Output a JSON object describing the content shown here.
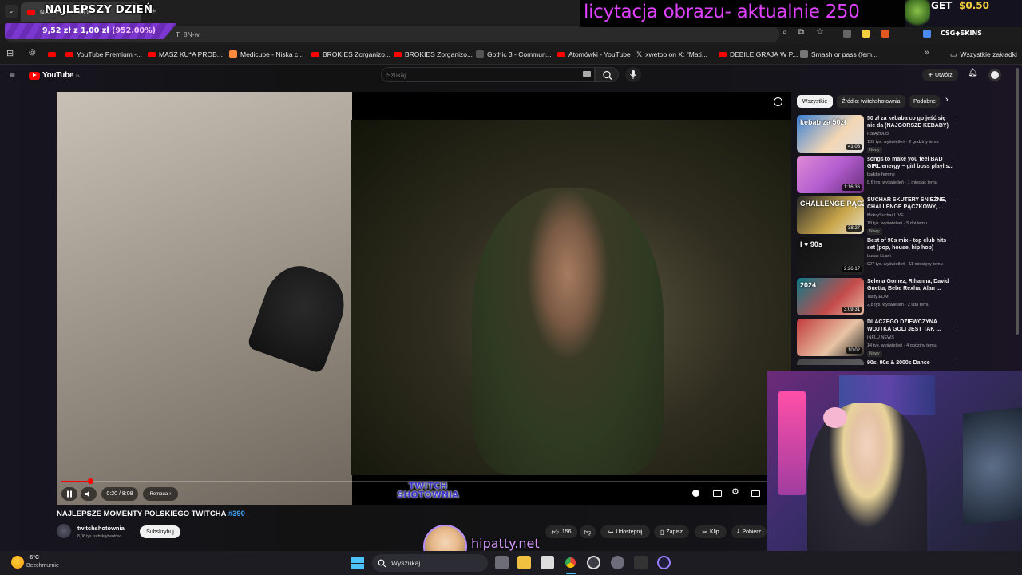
{
  "browser": {
    "tab_title": "NAJLEPSZE MO...",
    "url_fragment": "T_8N-w",
    "bookmarks": [
      "YouTube Premium -...",
      "MASZ KU*A PROB...",
      "Medicube - Niska c...",
      "BROKIES Zorganizo...",
      "BROKIES Zorganizo...",
      "Gothic 3 - Commun...",
      "Atomówki - YouTube",
      "xwetoo on X: \"Mati...",
      "DEBILE GRAJĄ W P...",
      "Smash or pass (fem..."
    ],
    "all_bookmarks": "Wszystkie zakładki"
  },
  "youtube": {
    "logo": "YouTube",
    "logo_region": "PL",
    "search_placeholder": "Szukaj",
    "create_label": "Utwórz",
    "video": {
      "title": "NAJLEPSZE MOMENTY POLSKIEGO TWITCHA",
      "hashtag": "#390",
      "time": "0:20 / 8:08",
      "chapter": "Remaua",
      "watermark": "TWITCH SHOTOWNIA",
      "progress": 0.04
    },
    "channel": {
      "name": "twitchshotownia",
      "subs": "8,06 tys. subskrybentów",
      "subscribe": "Subskrybuj"
    },
    "actions": {
      "likes": "156",
      "share": "Udostępnij",
      "save": "Zapisz",
      "clip": "Klip",
      "download": "Pobierz"
    },
    "chips": [
      "Wszystkie",
      "Źródło: twitchshotownia",
      "Podobne"
    ],
    "recommendations": [
      {
        "title": "50 zł za kebaba co go jeść się nie da (NAJGORSZE KEBABY)",
        "channel": "KSIĄŻULO",
        "meta": "139 tys. wyświetleń · 2 godziny temu",
        "badge": "Nowy",
        "duration": "41:06",
        "thumb_text": "kebab za 50zł"
      },
      {
        "title": "songs to make you feel BAD GIRL energy ~ girl boss playlis...",
        "channel": "baddie femme",
        "meta": "8,6 tys. wyświetleń · 1 miesiąc temu",
        "badge": "",
        "duration": "1:16:36",
        "thumb_text": ""
      },
      {
        "title": "SUCHAR SKUTERY ŚNIEŻNE, CHALLENGE PĄCZKOWY, ...",
        "channel": "MokrySuchar LIVE",
        "meta": "18 tys. wyświetleń · 5 dni temu",
        "badge": "Nowy",
        "duration": "38:27",
        "thumb_text": "CHALLENGE PĄCZK"
      },
      {
        "title": "Best of 90s mix - top club hits set (pop, house, hip hop)",
        "channel": "Lucas LLani",
        "meta": "927 tys. wyświetleń · 11 miesięcy temu",
        "badge": "",
        "duration": "2:26:17",
        "thumb_text": "I ♥ 90s"
      },
      {
        "title": "Selena Gomez, Rihanna, David Guetta, Bebe Rexha, Alan ...",
        "channel": "Tasty EDM",
        "meta": "2,8 tys. wyświetleń · 2 lata temu",
        "badge": "",
        "duration": "3:09:31",
        "thumb_text": "2024"
      },
      {
        "title": "DLACZEGO DZIEWCZYNA WOJTKA GOLI JEST TAK ...",
        "channel": "INFLU NEWS",
        "meta": "14 tys. wyświetleń · 4 godziny temu",
        "badge": "Nowy",
        "duration": "10:02",
        "thumb_text": ""
      },
      {
        "title": "90s, 90s & 2000s Dance",
        "channel": "",
        "meta": "",
        "badge": "",
        "duration": "",
        "thumb_text": ""
      }
    ]
  },
  "stream_overlay": {
    "goal_title": "NAJLEPSZY DZIEŃ",
    "goal_progress": "9,52 zł z 1,00 zł",
    "goal_percent": "(952.00%)",
    "auction": "licytacja obrazu-  aktualnie 250",
    "promo_get": "GET",
    "promo_amount": "$0.50",
    "promo_brand": "CSG◆SKINS",
    "streamer_site": "hipatty.net"
  },
  "taskbar": {
    "temperature": "-6°C",
    "weather": "Bezchmurnie",
    "search": "Wyszukaj"
  },
  "colors": {
    "yt_red": "#ff0000",
    "overlay_magenta": "#e040ff",
    "goal_purple": "#6a2bb5",
    "link_blue": "#3ea6ff"
  }
}
